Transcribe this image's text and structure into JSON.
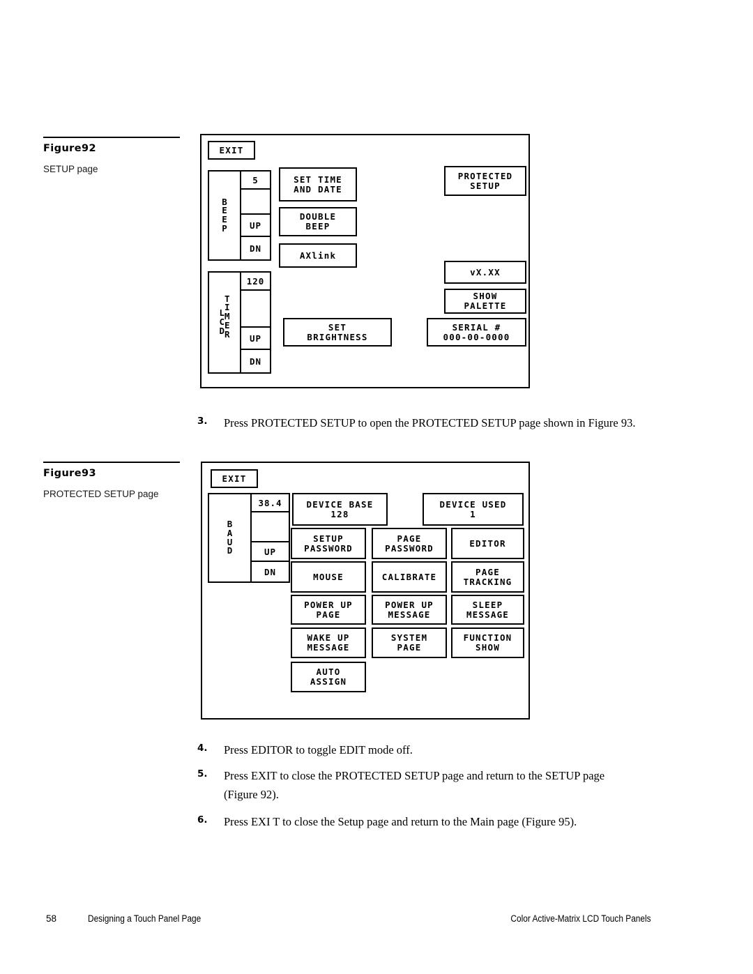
{
  "figure92": {
    "title": "Figure92",
    "subtitle": "SETUP page",
    "exit_label": "EXIT",
    "beep": {
      "label_left": "BEEP",
      "value": "5",
      "up_label": "UP",
      "dn_label": "DN"
    },
    "lcd_timer": {
      "label_left": "LCD",
      "label_right": "TIMER",
      "value": "120",
      "up_label": "UP",
      "dn_label": "DN"
    },
    "buttons": {
      "set_time_and_date": "SET TIME\nAND DATE",
      "double_beep": "DOUBLE\nBEEP",
      "axlink": "AXlink",
      "set_brightness": "SET\nBRIGHTNESS",
      "protected_setup": "PROTECTED\nSETUP",
      "version": "vX.XX",
      "show_palette": "SHOW\nPALETTE",
      "serial": "SERIAL #\n000-00-0000"
    }
  },
  "figure93": {
    "title": "Figure93",
    "subtitle": "PROTECTED SETUP page",
    "exit_label": "EXIT",
    "baud": {
      "label_left": "BAUD",
      "value": "38.4",
      "up_label": "UP",
      "dn_label": "DN"
    },
    "buttons": {
      "device_base": "DEVICE BASE\n128",
      "device_used": "DEVICE USED\n1",
      "setup_password": "SETUP\nPASSWORD",
      "page_password": "PAGE\nPASSWORD",
      "editor": "EDITOR",
      "mouse": "MOUSE",
      "calibrate": "CALIBRATE",
      "page_tracking": "PAGE\nTRACKING",
      "power_up_page": "POWER UP\nPAGE",
      "power_up_message": "POWER UP\nMESSAGE",
      "sleep_message": "SLEEP\nMESSAGE",
      "wake_up_message": "WAKE UP\nMESSAGE",
      "system_page": "SYSTEM\nPAGE",
      "function_show": "FUNCTION\nSHOW",
      "auto_assign": "AUTO\nASSIGN"
    }
  },
  "steps": [
    {
      "number": "3.",
      "text": "Press PROTECTED SETUP to open the PROTECTED SETUP page shown in Figure 93."
    },
    {
      "number": "4.",
      "text": "Press EDITOR to toggle EDIT mode off."
    },
    {
      "number": "5.",
      "text": "Press EXIT to close the PROTECTED SETUP page and return to the SETUP page (Figure 92)."
    },
    {
      "number": "6.",
      "text": "Press EXI T to close the Setup page and return to the Main page (Figure 95)."
    }
  ],
  "footer": {
    "page_number": "58",
    "section": "Designing a Touch Panel Page",
    "document": "Color Active-Matrix LCD Touch Panels"
  }
}
